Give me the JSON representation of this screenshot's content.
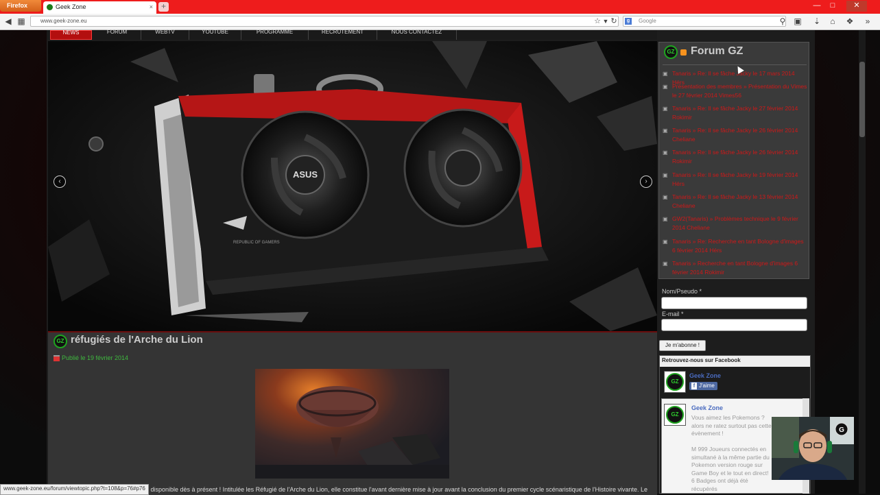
{
  "browser": {
    "menu_button": "Firefox",
    "tab_title": "Geek Zone",
    "tab_close": "×",
    "new_tab": "+",
    "url": "www.geek-zone.eu",
    "search_engine_icon": "google-icon",
    "search_placeholder": "Google",
    "status_url": "www.geek-zone.eu/forum/viewtopic.php?t=108&p=76#p76"
  },
  "menu": {
    "items": [
      "NEWS",
      "FORUM",
      "WEBTV",
      "YOUTUBE",
      "PROGRAMME",
      "RECRUTEMENT",
      "NOUS CONTACTEZ"
    ]
  },
  "hero": {
    "prev": "‹",
    "next": "›",
    "card_brand": "ASUS",
    "card_logo": "REPUBLIC OF GAMERS"
  },
  "article": {
    "title": "réfugiés de l'Arche du Lion",
    "published": "Publié le 19 février 2014",
    "text": "st disponible dès à présent ! Intitulée les Réfugié de l'Arche du Lion, elle constitue l'avant dernière mise à jour avant la conclusion du premier cycle scénaristique de l'Histoire vivante. Le"
  },
  "sidebar": {
    "logo_text": "GZ",
    "forum_title": "Forum GZ",
    "forum_items": [
      "Tanaris » Re: Il se fâche Jacky  le 17 mars 2014 Hérs",
      "Présentation des membres » Présentation du Vimes le 27 février 2014 Vimes56",
      "Tanaris » Re: Il se fâche Jacky  le 27 février 2014 Rokimir",
      "Tanaris » Re: Il se fâche Jacky  le 26 février 2014 Cheliane",
      "Tanaris » Re: Il se fâche Jacky  le 26 février 2014 Rokimir",
      "Tanaris » Re: Il se fâche Jacky  le 19 février 2014 Hérs",
      "Tanaris » Re: Il se fâche Jacky  le 13 février 2014 Cheliane",
      "GW2(Tanaris) » Problèmes technique le 9 février 2014 Cheliane",
      "Tanaris » Re: Recherche en tant Bologne d'images 6 février 2014 Hérs",
      "Tanaris » Recherche en tant Bologne d'images 6 février 2014 Rokimir"
    ],
    "name_label": "Nom/Pseudo *",
    "email_label": "E-mail *",
    "subscribe": "Je m'abonne !",
    "fb_header": "Retrouvez-nous sur Facebook",
    "fb_page_name": "Geek Zone",
    "fb_like": "J'aime",
    "fb_post_name": "Geek Zone",
    "fb_post_text": "Vous aimez les Pokemons ? alors ne ratez surtout pas cette évènement !\n\nM 999 Joueurs connectés en simultané à la même partie du Pokemon version rouge sur Game Boy et le tout en direct!\n6 Badges ont déjà été récupérés",
    "webcam_badge": "G"
  },
  "colors": {
    "accent_red": "#ee1c1c",
    "forum_link": "#d01818",
    "published_green": "#3fb93f",
    "facebook_blue": "#4e69a2"
  }
}
